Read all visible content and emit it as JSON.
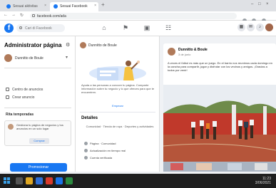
{
  "browser": {
    "tabs": [
      {
        "label": "Sesuai aktivitas"
      },
      {
        "label": "Sesuai Facebook"
      }
    ],
    "new_tab": "+",
    "tab_close": "×",
    "window_controls": [
      "–",
      "□",
      "×"
    ],
    "nav": [
      "←",
      "→",
      "↻"
    ],
    "url": "facebook.com/ada"
  },
  "fb_header": {
    "logo": "f",
    "search_placeholder": "Cari di Facebook",
    "nav_icons": [
      "home-icon",
      "flag-icon",
      "pages-icon",
      "groups-icon"
    ],
    "nav_glyphs": [
      "⌂",
      "⚑",
      "▣",
      "☷"
    ],
    "action_glyphs": [
      "▦",
      "✉",
      "♪"
    ]
  },
  "sidebar": {
    "title": "Administrator página",
    "page_name": "Dunnitto de Boule",
    "links": [
      "Centro de anuncios",
      "Crear anuncio"
    ],
    "section_title": "Rita temporadas",
    "card_text": "Gestiona tu página de negocios y tus anuncios en un solo lugar",
    "card_button": "Comprar",
    "promote_button": "Promocionar"
  },
  "middle": {
    "page_name": "Dunnitto de Boule",
    "intro_text": "Ayuda a las personas a conocer tu página. Comparte información sobre tu negocio y lo que ofreces para que te encuentren.",
    "intro_link": "Empezar",
    "section_title": "Detalles",
    "info_text": "Comunidad · Tienda de ropa · Deportes y actividades",
    "rows": [
      "Página · Comunidad",
      "Actualización en tiempo real",
      "Cuenta verificada"
    ]
  },
  "post": {
    "author": "Dunnitto & Boule",
    "date": "3 de junio",
    "text": "A veces el fútbol es más que un juego. En el barrio nos reunimos cada domingo en la cancha para compartir, jugar y disfrutar con los vecinos y amigos. ¡Gracias a todos por venir!"
  },
  "taskbar": {
    "time": "11:23",
    "date": "3/06/2021"
  },
  "colors": {
    "brand": "#1877f2",
    "wall": "#c0392b",
    "court": "#b5553a"
  }
}
